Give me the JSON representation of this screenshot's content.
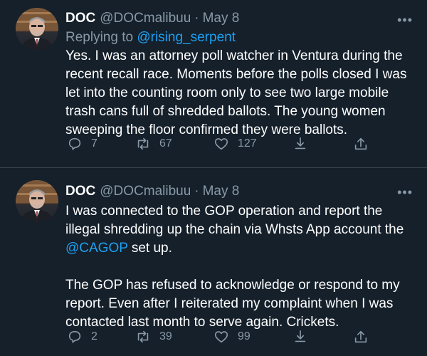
{
  "tweets": [
    {
      "name": "DOC",
      "handle": "@DOCmalibuu",
      "separator": "·",
      "date": "May 8",
      "more_icon": "more-dots-icon",
      "replying_label": "Replying to",
      "replying_to": "@rising_serpent",
      "text": "Yes. I was an attorney poll watcher in Ventura during the recent recall race. Moments before the polls closed I was let into the counting room only to see two large mobile trash cans full of shredded ballots. The young women sweeping the floor confirmed they were ballots.",
      "replies": "7",
      "retweets": "67",
      "likes": "127"
    },
    {
      "name": "DOC",
      "handle": "@DOCmalibuu",
      "separator": "·",
      "date": "May 8",
      "more_icon": "more-dots-icon",
      "text_part1": "I was connected to the GOP operation and report the illegal shredding up the chain via Whsts App account the ",
      "text_mention": "@CAGOP",
      "text_part2": " set up.",
      "text_para2": "The GOP has refused to acknowledge or respond to my report. Even after I reiterated my complaint when I was contacted last month to serve again. Crickets.",
      "replies": "2",
      "retweets": "39",
      "likes": "99"
    }
  ],
  "icons": {
    "reply": "reply-icon",
    "retweet": "retweet-icon",
    "like": "heart-icon",
    "share": "share-icon",
    "upload": "upload-icon"
  },
  "colors": {
    "background": "#15202b",
    "accent": "#1da1f2",
    "muted": "#8899a6",
    "divider": "#38444d"
  }
}
